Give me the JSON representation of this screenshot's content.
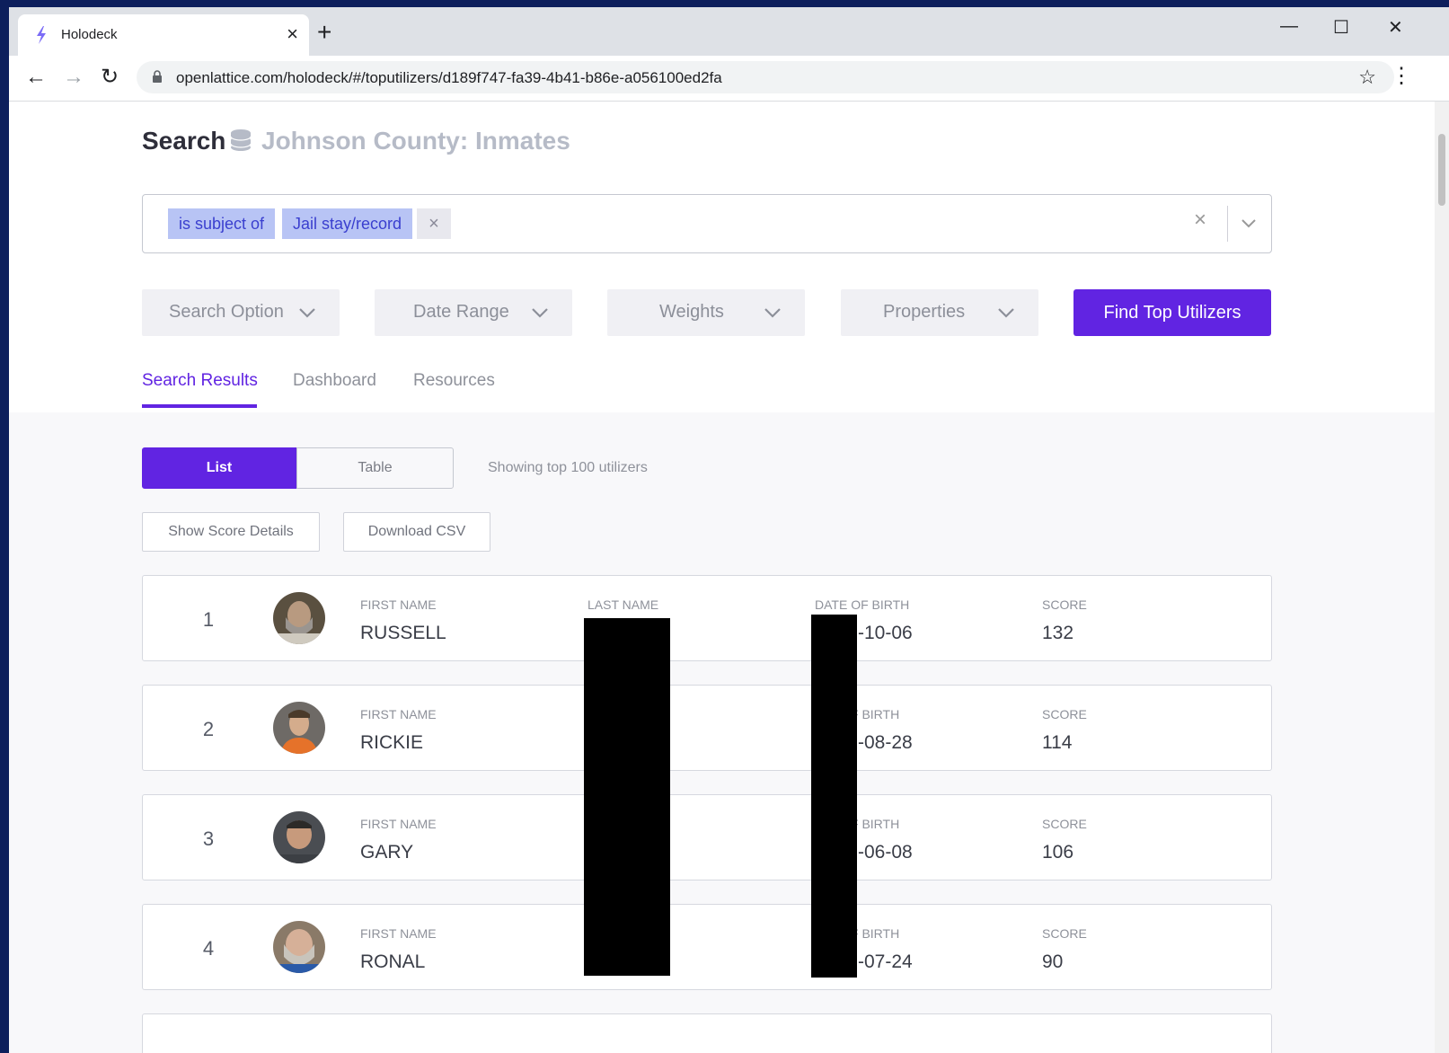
{
  "browser": {
    "tab_title": "Holodeck",
    "tab_close": "×",
    "new_tab": "+",
    "url": "openlattice.com/holodeck/#/toputilizers/d189f747-fa39-4b41-b86e-a056100ed2fa",
    "back": "←",
    "forward": "→",
    "reload": "↻",
    "star": "☆",
    "menu": "⋮",
    "win_minimize": "—",
    "win_maximize": "☐",
    "win_close": "✕"
  },
  "header": {
    "title": "Search",
    "dataset": "Johnson County: Inmates"
  },
  "search": {
    "chips": [
      "is subject of",
      "Jail stay/record"
    ],
    "chip_remove": "×",
    "clear": "×"
  },
  "filters": {
    "search_option": "Search Option",
    "date_range": "Date Range",
    "weights": "Weights",
    "properties": "Properties",
    "find_button": "Find Top Utilizers"
  },
  "tabs": [
    "Search Results",
    "Dashboard",
    "Resources"
  ],
  "view_toggle": {
    "list": "List",
    "table": "Table",
    "showing": "Showing top 100 utilizers"
  },
  "actions": {
    "show_score": "Show Score Details",
    "download_csv": "Download CSV"
  },
  "columns": {
    "first_name": "FIRST NAME",
    "last_name": "LAST NAME",
    "dob": "DATE OF BIRTH",
    "dob_partial": "F BIRTH",
    "score": "SCORE"
  },
  "results": [
    {
      "rank": "1",
      "first_name": "RUSSELL",
      "dob": "-10-06",
      "score": "132"
    },
    {
      "rank": "2",
      "first_name": "RICKIE",
      "dob": "-08-28",
      "score": "114"
    },
    {
      "rank": "3",
      "first_name": "GARY",
      "dob": "-06-08",
      "score": "106"
    },
    {
      "rank": "4",
      "first_name": "RONAL",
      "dob": "-07-24",
      "score": "90"
    }
  ],
  "colors": {
    "accent": "#6124e2",
    "chip_bg": "#b8c4f5",
    "chip_text": "#3a3fcf",
    "desktop": "#0d1f5c"
  }
}
